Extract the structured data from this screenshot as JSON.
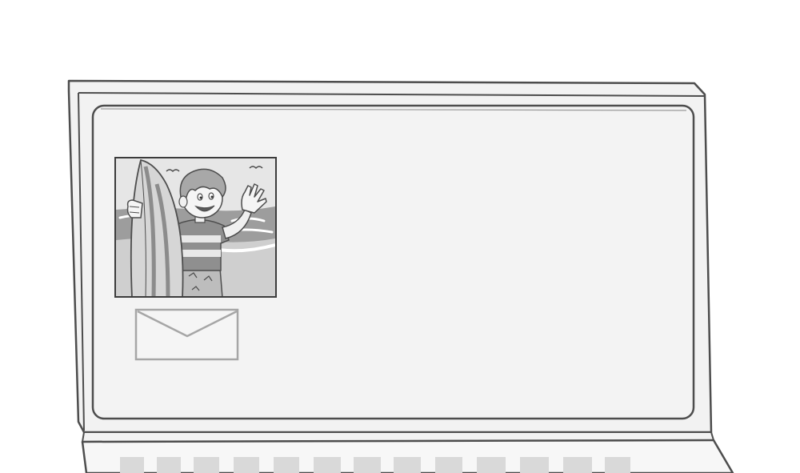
{
  "scene": {
    "device": "laptop",
    "photo_subject": "boy-with-surfboard-waving",
    "icons": [
      "envelope-icon"
    ],
    "colors": {
      "background": "#ffffff",
      "outline": "#4d4d4d",
      "frame": "#f2f2f2",
      "screen": "#f3f3f3",
      "photo_sky": "#e6e6e6",
      "sea": "#9d9d9d",
      "keys": "#d9d9d9",
      "envelope_stroke": "#a6a6a6"
    }
  }
}
